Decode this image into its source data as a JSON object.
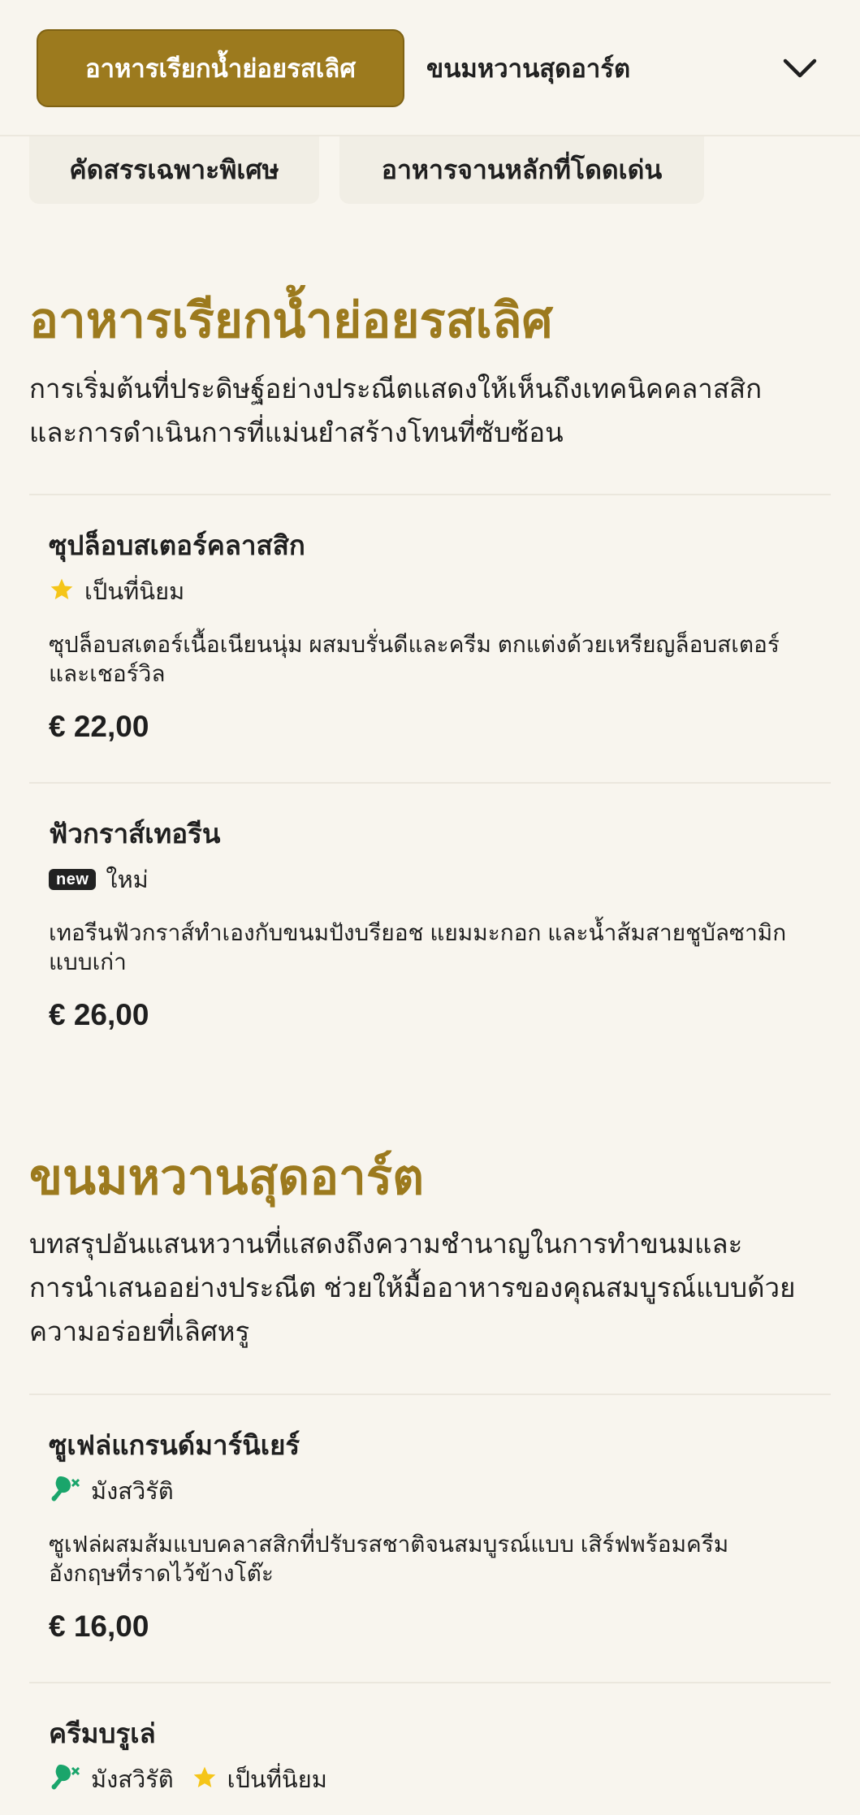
{
  "nav": {
    "tabs": [
      {
        "label": "อาหารเรียกน้ำย่อยรสเลิศ",
        "active": true
      },
      {
        "label": "ขนมหวานสุดอาร์ต",
        "active": false
      }
    ],
    "expand_icon": "chevron-down-icon",
    "chips": [
      {
        "label": "คัดสรรเฉพาะพิเศษ"
      },
      {
        "label": "อาหารจานหลักที่โดดเด่น"
      }
    ]
  },
  "sections": [
    {
      "title": "อาหารเรียกน้ำย่อยรสเลิศ",
      "description_lines": [
        "การเริ่มต้นที่ประดิษฐ์อย่างประณีตแสดงให้เห็นถึงเทคนิคคลาสสิก",
        "และการดำเนินการที่แม่นยำสร้างโทนที่ซับซ้อน"
      ],
      "items": [
        {
          "name": "ซุปล็อบสเตอร์คลาสสิก",
          "tags": [
            {
              "icon": "star-icon",
              "label": "เป็นที่นิยม"
            }
          ],
          "description_lines": [
            "ซุปล็อบสเตอร์เนื้อเนียนนุ่ม ผสมบรั่นดีและครีม ตกแต่งด้วยเหรียญล็อบสเตอร์",
            "และเชอร์วิล"
          ],
          "price": "€ 22,00"
        },
        {
          "name": "ฟัวกราส์เทอรีน",
          "tags": [
            {
              "icon": "new-badge-icon",
              "badge": "new",
              "label": "ใหม่"
            }
          ],
          "description_lines": [
            "เทอรีนฟัวกราส์ทำเองกับขนมปังบรียอช แยมมะกอก และน้ำส้มสายชูบัลซามิก",
            "แบบเก่า"
          ],
          "price": "€ 26,00"
        }
      ]
    },
    {
      "title": "ขนมหวานสุดอาร์ต",
      "description_lines": [
        "บทสรุปอันแสนหวานที่แสดงถึงความชำนาญในการทำขนมและ",
        "การนำเสนออย่างประณีต ช่วยให้มื้ออาหารของคุณสมบูรณ์แบบด้วย",
        "ความอร่อยที่เลิศหรู"
      ],
      "items": [
        {
          "name": "ซูเฟล่แกรนด์มาร์นิเยร์",
          "tags": [
            {
              "icon": "vegetarian-icon",
              "label": "มังสวิรัติ"
            }
          ],
          "description_lines": [
            "ซูเฟล่ผสมส้มแบบคลาสสิกที่ปรับรสชาติจนสมบูรณ์แบบ เสิร์ฟพร้อมครีม",
            "อังกฤษที่ราดไว้ข้างโต๊ะ"
          ],
          "price": "€ 16,00"
        },
        {
          "name": "ครีมบรูเล่",
          "tags": [
            {
              "icon": "vegetarian-icon",
              "label": "มังสวิรัติ"
            },
            {
              "icon": "star-icon",
              "label": "เป็นที่นิยม"
            }
          ]
        }
      ]
    }
  ],
  "colors": {
    "accent": "#9c7a1e",
    "background": "#f8f5ee",
    "chip": "#f1eee5",
    "star": "#f5c518",
    "vegetarian": "#1aa56b",
    "divider": "#ebe7dd"
  }
}
